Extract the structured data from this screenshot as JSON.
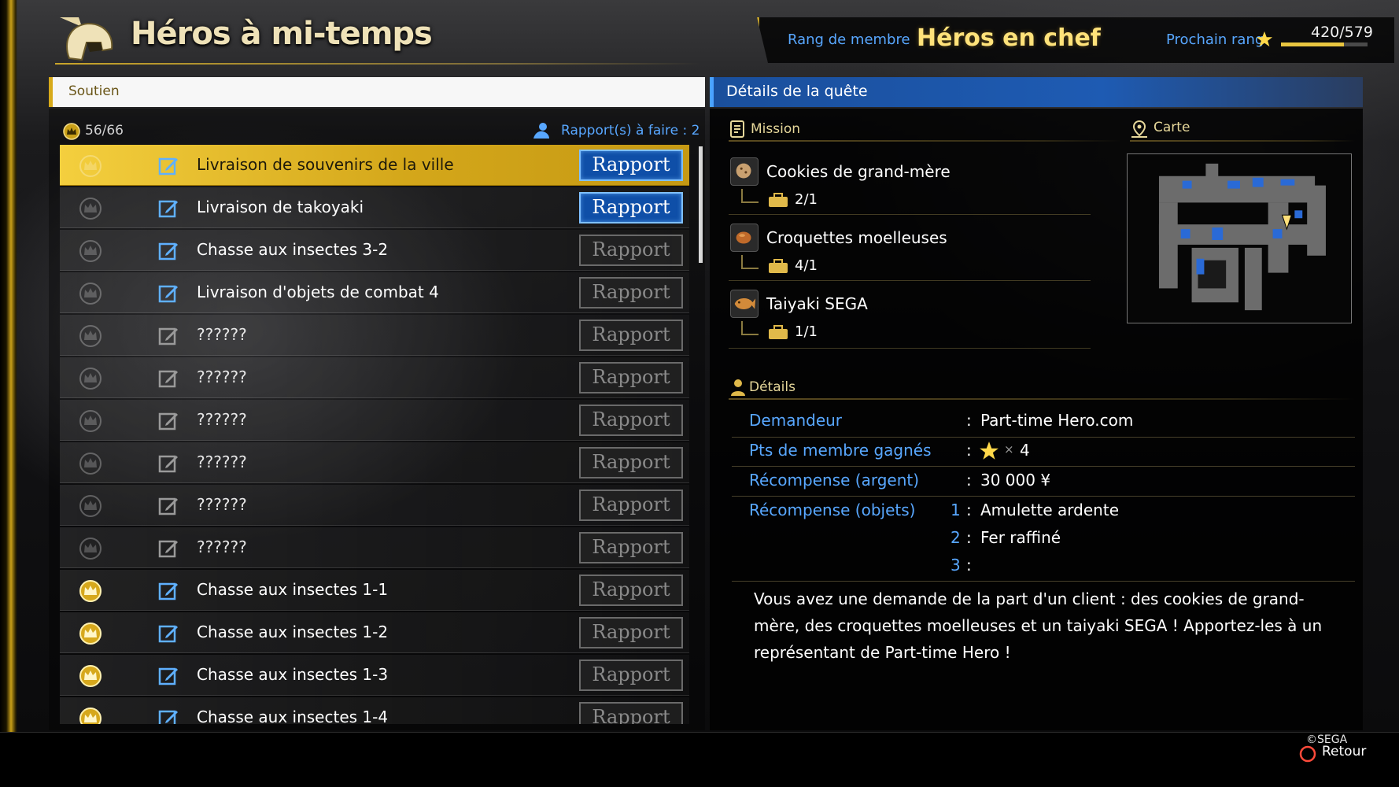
{
  "header": {
    "title": "Héros à mi-temps",
    "rank_label": "Rang de membre",
    "rank_value": "Héros en chef",
    "next_rank_label": "Prochain rang",
    "progress_text": "420/579",
    "progress_fraction": 0.725
  },
  "list": {
    "category": "Soutien",
    "crown_count": "56/66",
    "report_count": "Rapport(s) à faire : 2",
    "items": [
      {
        "name": "Livraison de souvenirs de la ville",
        "crown": "none",
        "report": "Rapport",
        "report_state": "active",
        "selected": true,
        "locked": false
      },
      {
        "name": "Livraison de takoyaki",
        "crown": "none",
        "report": "Rapport",
        "report_state": "active",
        "selected": false,
        "locked": false
      },
      {
        "name": "Chasse aux insectes 3-2",
        "crown": "none",
        "report": "Rapport",
        "report_state": "inactive",
        "selected": false,
        "locked": false
      },
      {
        "name": "Livraison d'objets de combat 4",
        "crown": "none",
        "report": "Rapport",
        "report_state": "inactive",
        "selected": false,
        "locked": false
      },
      {
        "name": "??????",
        "crown": "none",
        "report": "Rapport",
        "report_state": "inactive",
        "selected": false,
        "locked": true
      },
      {
        "name": "??????",
        "crown": "none",
        "report": "Rapport",
        "report_state": "inactive",
        "selected": false,
        "locked": true
      },
      {
        "name": "??????",
        "crown": "none",
        "report": "Rapport",
        "report_state": "inactive",
        "selected": false,
        "locked": true
      },
      {
        "name": "??????",
        "crown": "none",
        "report": "Rapport",
        "report_state": "inactive",
        "selected": false,
        "locked": true
      },
      {
        "name": "??????",
        "crown": "none",
        "report": "Rapport",
        "report_state": "inactive",
        "selected": false,
        "locked": true
      },
      {
        "name": "??????",
        "crown": "none",
        "report": "Rapport",
        "report_state": "inactive",
        "selected": false,
        "locked": true
      },
      {
        "name": "Chasse aux insectes 1-1",
        "crown": "gold",
        "report": "Rapport",
        "report_state": "inactive",
        "selected": false,
        "locked": false
      },
      {
        "name": "Chasse aux insectes 1-2",
        "crown": "gold",
        "report": "Rapport",
        "report_state": "inactive",
        "selected": false,
        "locked": false
      },
      {
        "name": "Chasse aux insectes 1-3",
        "crown": "gold",
        "report": "Rapport",
        "report_state": "inactive",
        "selected": false,
        "locked": false
      },
      {
        "name": "Chasse aux insectes 1-4",
        "crown": "gold",
        "report": "Rapport",
        "report_state": "inactive",
        "selected": false,
        "locked": false
      }
    ]
  },
  "details": {
    "title": "Détails de la quête",
    "mission_label": "Mission",
    "map_label": "Carte",
    "missions": [
      {
        "name": "Cookies de grand-mère",
        "count": "2/1",
        "icon": "cookie-icon"
      },
      {
        "name": "Croquettes moelleuses",
        "count": "4/1",
        "icon": "croquette-icon"
      },
      {
        "name": "Taiyaki SEGA",
        "count": "1/1",
        "icon": "taiyaki-icon"
      }
    ],
    "details_label": "Détails",
    "requester_label": "Demandeur",
    "requester_value": "Part-time Hero.com",
    "points_label": "Pts de membre gagnés",
    "points_multiplier": "×",
    "points_value": "4",
    "money_label": "Récompense (argent)",
    "money_value": "30 000 ¥",
    "items_label": "Récompense (objets)",
    "reward_items": [
      {
        "index": "1",
        "name": "Amulette ardente"
      },
      {
        "index": "2",
        "name": "Fer raffiné"
      },
      {
        "index": "3",
        "name": ""
      }
    ],
    "description": "Vous avez une demande de la part d'un client : des cookies de grand-mère, des croquettes moelleuses et un taiyaki SEGA ! Apportez-les à un représentant de Part-time Hero !"
  },
  "footer": {
    "copyright": "©SEGA",
    "back_label": "Retour"
  },
  "colors": {
    "accent_blue": "#58a7ff",
    "gold": "#d4a71a",
    "rank_gold": "#ffe27a"
  }
}
